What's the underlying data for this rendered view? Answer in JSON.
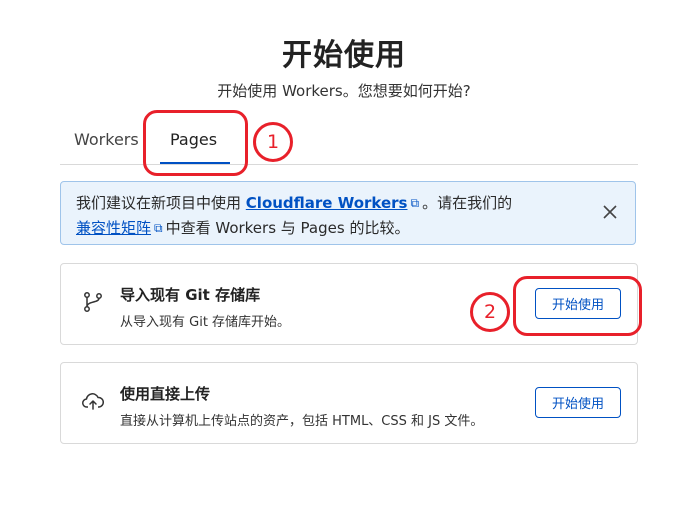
{
  "header": {
    "title": "开始使用",
    "subtitle": "开始使用 Workers。您想要如何开始?"
  },
  "tabs": [
    {
      "label": "Workers",
      "active": false
    },
    {
      "label": "Pages",
      "active": true
    }
  ],
  "notice": {
    "text1": "我们建议在新项目中使用",
    "link1": "Cloudflare Workers",
    "text2": "。请在我们的",
    "link2": "兼容性矩阵",
    "text3": "中查看 Workers 与 Pages 的比较。"
  },
  "cards": [
    {
      "title": "导入现有 Git 存储库",
      "description": "从导入现有 Git 存储库开始。",
      "button": "开始使用",
      "icon": "git-branch-icon"
    },
    {
      "title": "使用直接上传",
      "description": "直接从计算机上传站点的资产，包括 HTML、CSS 和 JS 文件。",
      "button": "开始使用",
      "icon": "cloud-upload-icon"
    }
  ],
  "annotations": {
    "marker1": "1",
    "marker2": "2"
  },
  "colors": {
    "accent": "#0051c3",
    "annotation": "#e8202a",
    "notice_bg": "#eaf3fc"
  }
}
